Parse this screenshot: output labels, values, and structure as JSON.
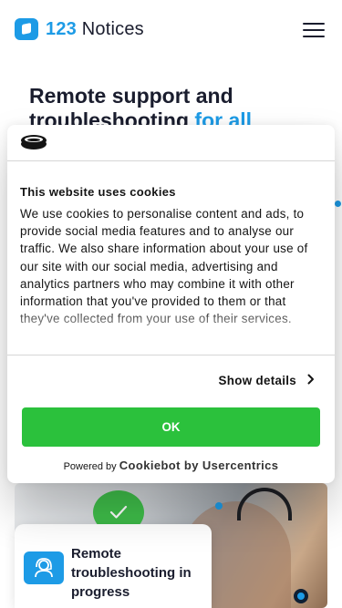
{
  "header": {
    "logo_number": "123",
    "logo_word": "Notices"
  },
  "hero": {
    "title_line1": "Remote support and",
    "title_line2": "troubleshooting ",
    "title_accent": "for all"
  },
  "cookie_dialog": {
    "title": "This website uses cookies",
    "body": "We use cookies to personalise content and ads, to provide social media features and to analyse our traffic. We also share information about your use of our site with our social media, advertising and analytics partners who may combine it with other information that you've provided to them or that they've collected from your use of their services.",
    "show_details_label": "Show details",
    "ok_label": "OK",
    "powered_by": "Powered by ",
    "powered_brand": "Cookiebot by Usercentrics"
  },
  "status_card": {
    "text": "Remote troubleshooting in progress"
  },
  "colors": {
    "accent": "#1d9be6",
    "ok_button": "#2bc13c",
    "check": "#3fbe4a"
  },
  "icons": {
    "logo": "box-icon",
    "menu": "hamburger-icon",
    "cookiebot": "cookiebot-logo",
    "chevron": "chevron-right-icon",
    "check": "check-icon",
    "support": "headset-support-icon"
  }
}
